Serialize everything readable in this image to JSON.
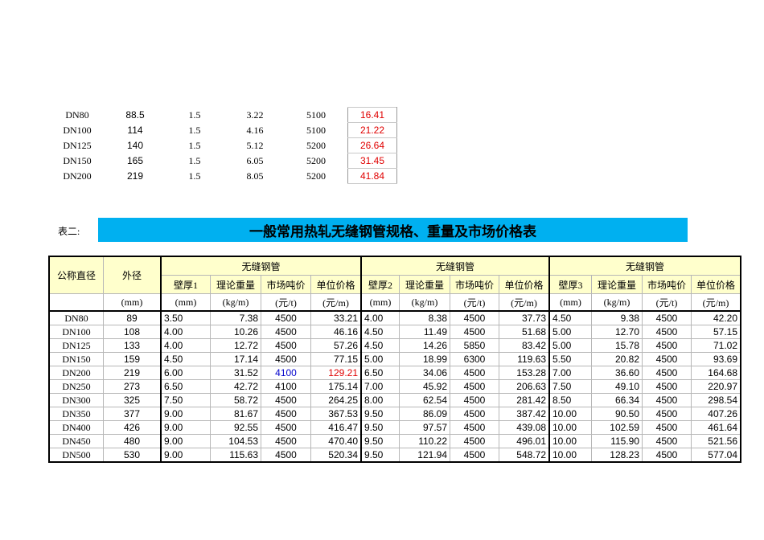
{
  "top_rows": [
    {
      "name": "DN80",
      "od": "88.5",
      "wall": "1.5",
      "weight": "3.22",
      "price": "5100",
      "unit_price": "16.41"
    },
    {
      "name": "DN100",
      "od": "114",
      "wall": "1.5",
      "weight": "4.16",
      "price": "5100",
      "unit_price": "21.22"
    },
    {
      "name": "DN125",
      "od": "140",
      "wall": "1.5",
      "weight": "5.12",
      "price": "5200",
      "unit_price": "26.64"
    },
    {
      "name": "DN150",
      "od": "165",
      "wall": "1.5",
      "weight": "6.05",
      "price": "5200",
      "unit_price": "31.45"
    },
    {
      "name": "DN200",
      "od": "219",
      "wall": "1.5",
      "weight": "8.05",
      "price": "5200",
      "unit_price": "41.84"
    }
  ],
  "table2": {
    "label": "表二:",
    "title": "一般常用热轧无缝钢管规格、重量及市场价格表",
    "headers": {
      "nominal": "公称直径",
      "od": "外径",
      "group": "无缝钢管",
      "wall1": "壁厚1",
      "wall2": "壁厚2",
      "wall3": "壁厚3",
      "weight": "理论重量",
      "price": "市场吨价",
      "unit_price": "单位价格"
    },
    "units": {
      "mm": "(mm)",
      "kgm": "(kg/m)",
      "yuan_t": "(元/t)",
      "yuan_m": "(元/m)"
    },
    "rows": [
      {
        "name": "DN80",
        "od": "89",
        "g": [
          [
            "3.50",
            "7.38",
            "4500",
            "33.21"
          ],
          [
            "4.00",
            "8.38",
            "4500",
            "37.73"
          ],
          [
            "4.50",
            "9.38",
            "4500",
            "42.20"
          ]
        ]
      },
      {
        "name": "DN100",
        "od": "108",
        "g": [
          [
            "4.00",
            "10.26",
            "4500",
            "46.16"
          ],
          [
            "4.50",
            "11.49",
            "4500",
            "51.68"
          ],
          [
            "5.00",
            "12.70",
            "4500",
            "57.15"
          ]
        ]
      },
      {
        "name": "DN125",
        "od": "133",
        "g": [
          [
            "4.00",
            "12.72",
            "4500",
            "57.26"
          ],
          [
            "4.50",
            "14.26",
            "5850",
            "83.42"
          ],
          [
            "5.00",
            "15.78",
            "4500",
            "71.02"
          ]
        ]
      },
      {
        "name": "DN150",
        "od": "159",
        "g": [
          [
            "4.50",
            "17.14",
            "4500",
            "77.15"
          ],
          [
            "5.00",
            "18.99",
            "6300",
            "119.63"
          ],
          [
            "5.50",
            "20.82",
            "4500",
            "93.69"
          ]
        ]
      },
      {
        "name": "DN200",
        "od": "219",
        "g": [
          [
            "6.00",
            "31.52",
            "4100",
            "129.21"
          ],
          [
            "6.50",
            "34.06",
            "4500",
            "153.28"
          ],
          [
            "7.00",
            "36.60",
            "4500",
            "164.68"
          ]
        ]
      },
      {
        "name": "DN250",
        "od": "273",
        "g": [
          [
            "6.50",
            "42.72",
            "4100",
            "175.14"
          ],
          [
            "7.00",
            "45.92",
            "4500",
            "206.63"
          ],
          [
            "7.50",
            "49.10",
            "4500",
            "220.97"
          ]
        ]
      },
      {
        "name": "DN300",
        "od": "325",
        "g": [
          [
            "7.50",
            "58.72",
            "4500",
            "264.25"
          ],
          [
            "8.00",
            "62.54",
            "4500",
            "281.42"
          ],
          [
            "8.50",
            "66.34",
            "4500",
            "298.54"
          ]
        ]
      },
      {
        "name": "DN350",
        "od": "377",
        "g": [
          [
            "9.00",
            "81.67",
            "4500",
            "367.53"
          ],
          [
            "9.50",
            "86.09",
            "4500",
            "387.42"
          ],
          [
            "10.00",
            "90.50",
            "4500",
            "407.26"
          ]
        ]
      },
      {
        "name": "DN400",
        "od": "426",
        "g": [
          [
            "9.00",
            "92.55",
            "4500",
            "416.47"
          ],
          [
            "9.50",
            "97.57",
            "4500",
            "439.08"
          ],
          [
            "10.00",
            "102.59",
            "4500",
            "461.64"
          ]
        ]
      },
      {
        "name": "DN450",
        "od": "480",
        "g": [
          [
            "9.00",
            "104.53",
            "4500",
            "470.40"
          ],
          [
            "9.50",
            "110.22",
            "4500",
            "496.01"
          ],
          [
            "10.00",
            "115.90",
            "4500",
            "521.56"
          ]
        ]
      },
      {
        "name": "DN500",
        "od": "530",
        "g": [
          [
            "9.00",
            "115.63",
            "4500",
            "520.34"
          ],
          [
            "9.50",
            "121.94",
            "4500",
            "548.72"
          ],
          [
            "10.00",
            "128.23",
            "4500",
            "577.04"
          ]
        ]
      }
    ]
  },
  "colors": {
    "banner": "#00b0f0",
    "header_fill": "#ffffcc",
    "red_text": "#e00000",
    "blue_text": "#0000cc"
  }
}
